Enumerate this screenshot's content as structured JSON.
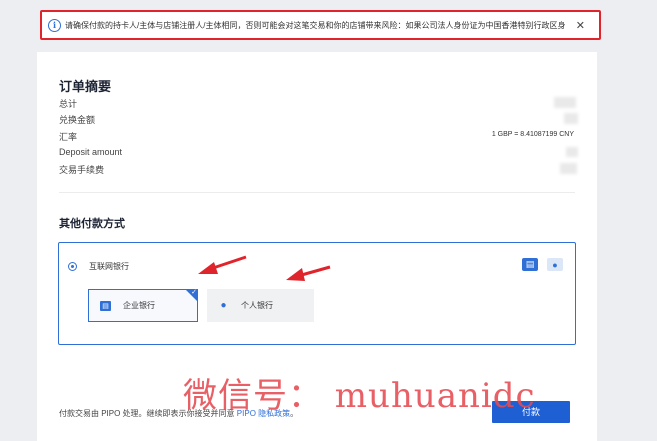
{
  "banner": {
    "text": "请确保付款的持卡人/主体与店铺注册人/主体相同，否则可能会对这笔交易和你的店铺带来风险：如果公司法人身份证为中国香港特别行政区身",
    "close": "✕"
  },
  "summary": {
    "title": "订单摘要",
    "rows": {
      "total": "总计",
      "converted": "兑换金额",
      "rate": "汇率",
      "deposit": "Deposit amount",
      "fee": "交易手续费"
    },
    "rate_value": "1 GBP = 8.41087199 CNY"
  },
  "other_methods": {
    "title": "其他付款方式",
    "method_label": "互联网银行",
    "options": {
      "business": "企业银行",
      "personal": "个人银行"
    }
  },
  "footer": {
    "text_before": "付款交易由 PIPO 处理。继续即表示你接受并同意 ",
    "link": "PIPO 隐私政策",
    "text_after": "。",
    "pay_button": "付款"
  },
  "watermark": "微信号： muhuanidc",
  "colors": {
    "accent": "#2f6fd6",
    "banner_border": "#e1242b",
    "annotation_arrow": "#e0242b"
  },
  "icons": [
    "info-icon",
    "close-icon",
    "building-icon",
    "person-icon",
    "checkmark-icon"
  ]
}
